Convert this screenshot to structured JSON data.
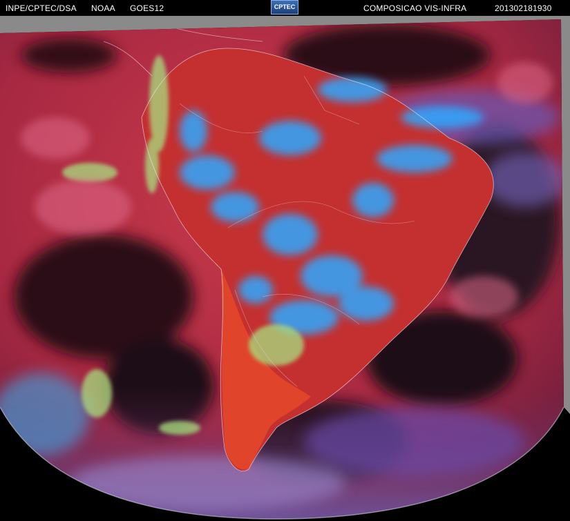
{
  "header": {
    "source": "INPE/CPTEC/DSA",
    "agency": "NOAA",
    "satellite": "GOES12",
    "product": "COMPOSICAO VIS-INFRA",
    "timestamp": "201302181930"
  },
  "logo": {
    "text": "CPTEC"
  },
  "colors": {
    "ocean_base": "#b52a44",
    "land_base": "#c83232",
    "cloud_cyan": "#2ea8ff",
    "cloud_green": "#9fe07a",
    "night_dark": "#1a0f14",
    "space_black": "#000000",
    "offdisk_gray": "#8a8a8a"
  }
}
